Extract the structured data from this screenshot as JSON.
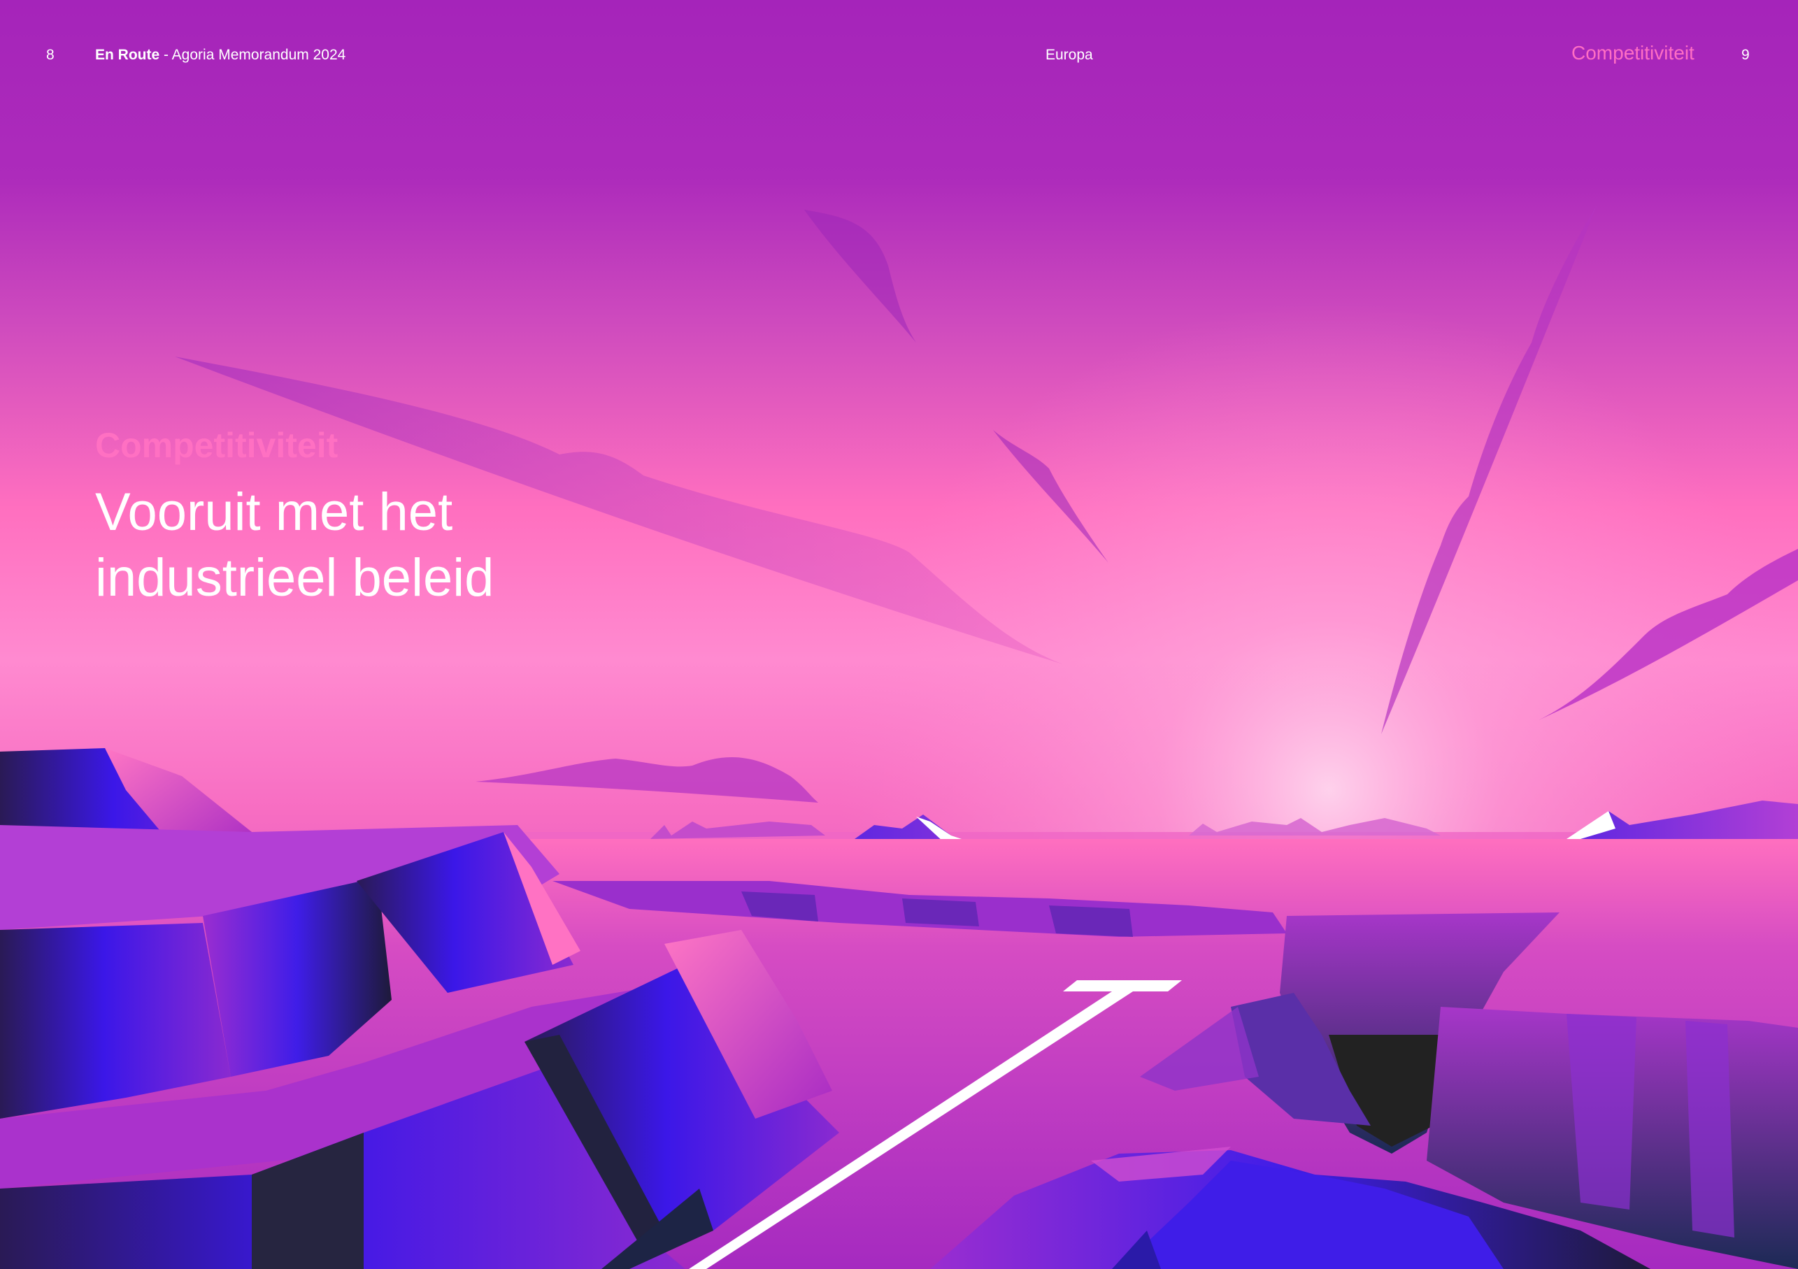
{
  "header": {
    "page_left": "8",
    "running_title_bold": "En Route",
    "running_title_rest": " - Agoria Memorandum 2024",
    "section_center": "Europa",
    "section_right": "Competitiviteit",
    "page_right": "9"
  },
  "main": {
    "kicker": "Competitiviteit",
    "title_line1": "Vooruit met het",
    "title_line2": "industrieel beleid"
  },
  "colors": {
    "background": "#a726bb",
    "accent_pink": "#ff6ec4",
    "rock_blue": "#3f1de8",
    "text": "#ffffff"
  }
}
